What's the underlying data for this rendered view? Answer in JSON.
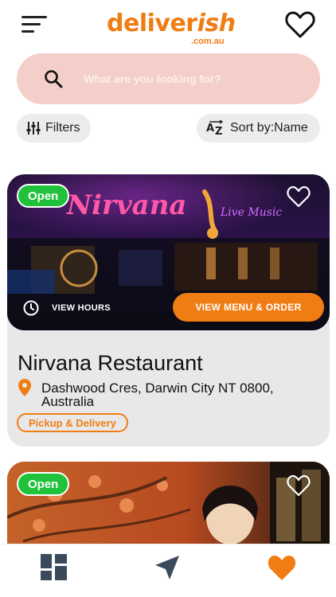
{
  "header": {
    "logo_main": "deliver",
    "logo_ish": "ish",
    "logo_sub": ".com.au",
    "menu_icon": "hamburger-icon",
    "favorites_icon": "heart-outline-icon"
  },
  "search": {
    "placeholder": "What are you looking for?",
    "icon": "search-icon"
  },
  "toolbar": {
    "filters_label": "Filters",
    "sort_label": "Sort by:Name"
  },
  "restaurants": [
    {
      "status": "Open",
      "name": "Nirvana Restaurant",
      "address": "Dashwood Cres, Darwin City NT 0800, Australia",
      "hours_label": "VIEW HOURS",
      "order_label": "VIEW MENU & ORDER",
      "tag": "Pickup & Delivery",
      "sign_text": "Nirvana",
      "sign_sub": "Live Music"
    },
    {
      "status": "Open"
    }
  ],
  "bottom_nav": {
    "items": [
      "dashboard-icon",
      "location-arrow-icon",
      "heart-filled-icon"
    ]
  },
  "colors": {
    "brand_orange": "#f07d14",
    "open_green": "#1fc23a",
    "search_bg": "#f4cfc9",
    "chip_bg": "#ececec",
    "card_bg": "#e8e8e8"
  }
}
